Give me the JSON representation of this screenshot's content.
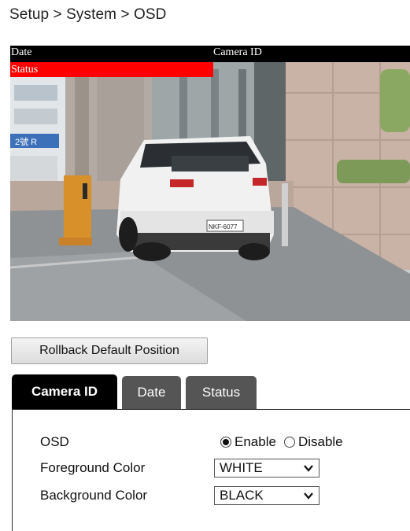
{
  "breadcrumb": "Setup > System > OSD",
  "osd_preview": {
    "date": "Date",
    "camera_id": "Camera ID",
    "status": "Status",
    "license_plate": "NKF-6077",
    "building_sign": "2號 R"
  },
  "rollback_label": "Rollback Default Position",
  "tabs": [
    {
      "label": "Camera ID",
      "active": true
    },
    {
      "label": "Date",
      "active": false
    },
    {
      "label": "Status",
      "active": false
    }
  ],
  "form": {
    "osd_label": "OSD",
    "enable_label": "Enable",
    "disable_label": "Disable",
    "selected": "Enable",
    "foreground_label": "Foreground Color",
    "foreground_value": "WHITE",
    "background_label": "Background Color",
    "background_value": "BLACK"
  },
  "colors": {
    "osd_bar": "#000000",
    "status_bar": "#ff0000",
    "tab_active": "#000000",
    "tab_inactive": "#555555"
  }
}
